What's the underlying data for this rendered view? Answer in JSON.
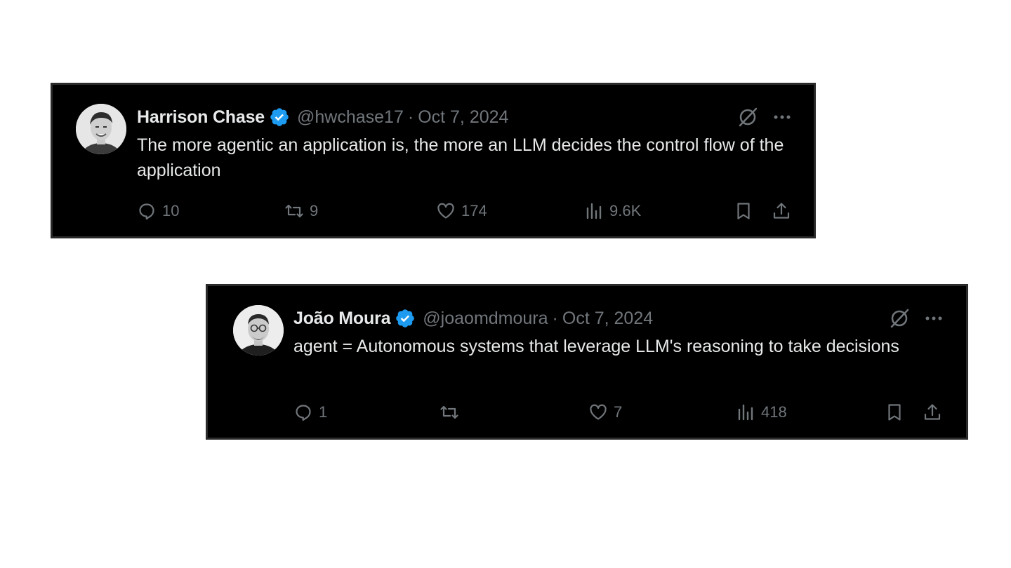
{
  "tweets": [
    {
      "name": "Harrison Chase",
      "handle": "@hwchase17",
      "separator": "·",
      "date": "Oct 7, 2024",
      "text": "The more agentic an application is, the more an LLM decides the control flow of the application",
      "stats": {
        "replies": "10",
        "reposts": "9",
        "likes": "174",
        "views": "9.6K"
      },
      "avatar_icon": "person-avatar",
      "verified_icon": "verified-badge-icon"
    },
    {
      "name": "João Moura",
      "handle": "@joaomdmoura",
      "separator": "·",
      "date": "Oct 7, 2024",
      "text": "agent = Autonomous systems that leverage LLM's reasoning to take decisions",
      "stats": {
        "replies": "1",
        "reposts": "",
        "likes": "7",
        "views": "418"
      },
      "avatar_icon": "person-avatar",
      "verified_icon": "verified-badge-icon"
    }
  ],
  "colors": {
    "card_background": "#000000",
    "primary_text": "#e7e9ea",
    "secondary_text": "#71767b",
    "verified_blue": "#1d9bf0",
    "page_background": "#ffffff"
  }
}
